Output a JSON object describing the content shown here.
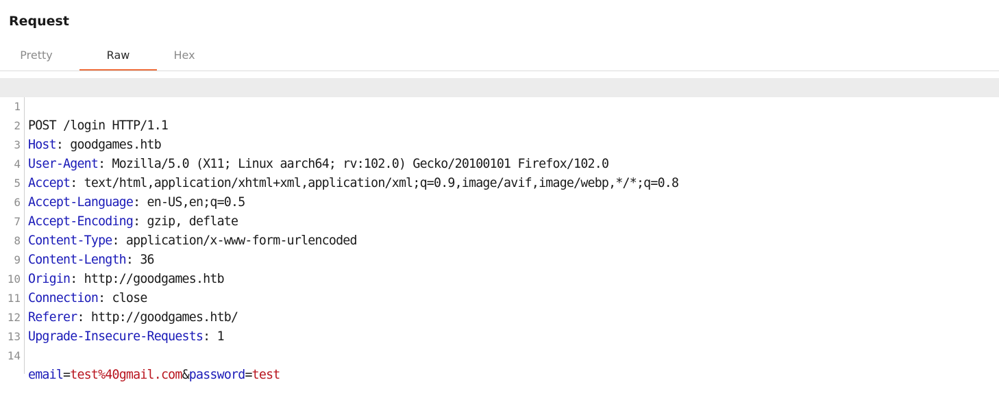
{
  "panel": {
    "title": "Request"
  },
  "tabs": [
    {
      "label": "Pretty",
      "active": false
    },
    {
      "label": "Raw",
      "active": true
    },
    {
      "label": "Hex",
      "active": false
    }
  ],
  "colors": {
    "accent_underline": "#ee6d3a",
    "header_name": "#1a1ab8",
    "param_value": "#b8141e"
  },
  "request": {
    "request_line": "POST /login HTTP/1.1",
    "headers": [
      {
        "name": "Host",
        "sep": ": ",
        "value": "goodgames.htb"
      },
      {
        "name": "User-Agent",
        "sep": ": ",
        "value": "Mozilla/5.0 (X11; Linux aarch64; rv:102.0) Gecko/20100101 Firefox/102.0"
      },
      {
        "name": "Accept",
        "sep": ": ",
        "value": "text/html,application/xhtml+xml,application/xml;q=0.9,image/avif,image/webp,*/*;q=0.8"
      },
      {
        "name": "Accept-Language",
        "sep": ": ",
        "value": "en-US,en;q=0.5"
      },
      {
        "name": "Accept-Encoding",
        "sep": ": ",
        "value": "gzip, deflate"
      },
      {
        "name": "Content-Type",
        "sep": ": ",
        "value": "application/x-www-form-urlencoded"
      },
      {
        "name": "Content-Length",
        "sep": ": ",
        "value": "36"
      },
      {
        "name": "Origin",
        "sep": ": ",
        "value": "http://goodgames.htb"
      },
      {
        "name": "Connection",
        "sep": ": ",
        "value": "close"
      },
      {
        "name": "Referer",
        "sep": ": ",
        "value": "http://goodgames.htb/"
      },
      {
        "name": "Upgrade-Insecure-Requests",
        "sep": ": ",
        "value": "1"
      }
    ],
    "body_params": [
      {
        "name": "email",
        "eq": "=",
        "value": "test%40gmail.com",
        "amp": "&"
      },
      {
        "name": "password",
        "eq": "=",
        "value": "test",
        "amp": ""
      }
    ]
  },
  "line_numbers": [
    "1",
    "2",
    "3",
    "4",
    "5",
    "6",
    "7",
    "8",
    "9",
    "10",
    "11",
    "12",
    "13",
    "14"
  ]
}
